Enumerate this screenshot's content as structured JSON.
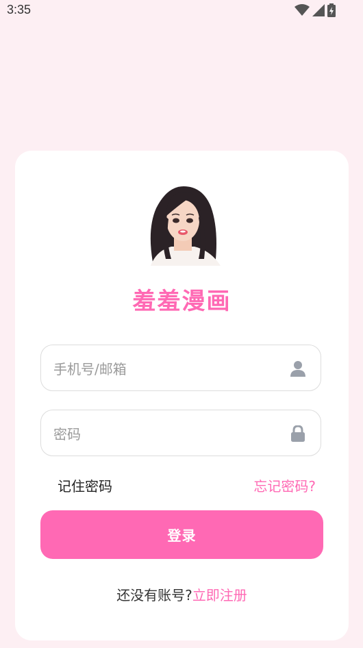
{
  "status_bar": {
    "time": "3:35",
    "icons": [
      "wifi-icon",
      "signal-icon",
      "battery-icon"
    ]
  },
  "app": {
    "title": "羞羞漫画",
    "accent_color": "#ff69b4",
    "background_color": "#fdeff3"
  },
  "form": {
    "account_placeholder": "手机号/邮箱",
    "account_icon": "user-icon",
    "password_placeholder": "密码",
    "password_icon": "lock-icon",
    "remember_label": "记住密码",
    "forgot_label": "忘记密码?",
    "login_label": "登录"
  },
  "register": {
    "prompt": "还没有账号?",
    "link_label": "立即注册"
  }
}
